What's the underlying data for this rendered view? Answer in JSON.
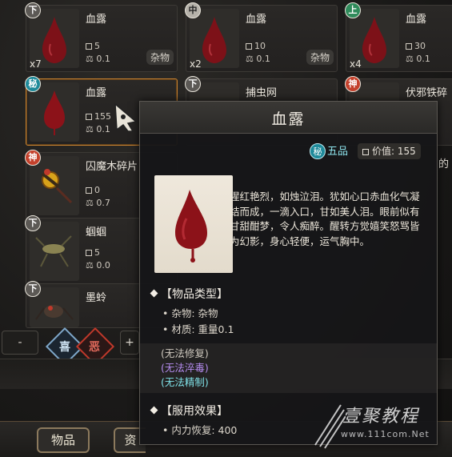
{
  "grid": {
    "cards": [
      {
        "badge": "下",
        "tier": "xia",
        "name": "血露",
        "weight_count": "5",
        "load": "0.1",
        "qty": "x7",
        "category": "杂物"
      },
      {
        "badge": "中",
        "tier": "zhong",
        "name": "血露",
        "weight_count": "10",
        "load": "0.1",
        "qty": "x2",
        "category": "杂物"
      },
      {
        "badge": "上",
        "tier": "shang",
        "name": "血露",
        "weight_count": "30",
        "load": "0.1",
        "qty": "x4",
        "category": ""
      },
      {
        "badge": "秘",
        "tier": "mi",
        "name": "血露",
        "weight_count": "155",
        "load": "0.1",
        "qty": "",
        "category": ""
      },
      {
        "badge": "下",
        "tier": "xia",
        "name": "捕虫网",
        "weight_count": "",
        "load": "",
        "qty": "",
        "category": ""
      },
      {
        "badge": "神",
        "tier": "shen",
        "name": "伏邪铁碎",
        "weight_count": "",
        "load": "",
        "qty": "",
        "category": ""
      },
      {
        "badge": "神",
        "tier": "shen",
        "name": "囚魔木碎片",
        "weight_count": "0",
        "load": "0.7",
        "qty": "",
        "category": ""
      },
      {
        "badge": "下",
        "tier": "xia",
        "name": "蝈蝈",
        "weight_count": "5",
        "load": "0.0",
        "qty": "",
        "category": ""
      },
      {
        "badge": "下",
        "tier": "xia",
        "name": "墨蛉",
        "weight_count": "",
        "load": "",
        "qty": "",
        "category": ""
      }
    ],
    "right_edge_text": "的"
  },
  "filter_bar": {
    "minus_label": "-",
    "like_label": "喜",
    "dislike_label": "恶",
    "plus_label": "+"
  },
  "tabs": {
    "items_label": "物品",
    "resources_label": "资"
  },
  "tooltip": {
    "title": "血露",
    "rarity_badge": "秘",
    "rarity_text": "五品",
    "value_label": "价值: 155",
    "description": "猩红艳烈，如烛泣泪。犹如心口赤血化气凝结而成，一滴入口，甘如美人泪。眼前似有甘甜酣梦，令人痴醉。醒转方觉嬉笑怒骂皆为幻影，身心轻便，运气胸中。",
    "section_type_title": "【物品类型】",
    "type_line1": "• 杂物: 杂物",
    "type_line2": "• 材质: 重量0.1",
    "flag_repair": "(无法修复)",
    "flag_quench": "(无法淬毒)",
    "flag_refine": "(无法精制)",
    "section_effect_title": "【服用效果】",
    "effect_line": "• 内力恢复: 400"
  },
  "watermark": {
    "text": "壹聚教程",
    "url": "www.111com.Net"
  },
  "colors": {
    "selected_border": "#c7812f",
    "purple_flag": "#b58cf0",
    "cyan_flag": "#7fe0e6",
    "blood": "#8c1219"
  }
}
